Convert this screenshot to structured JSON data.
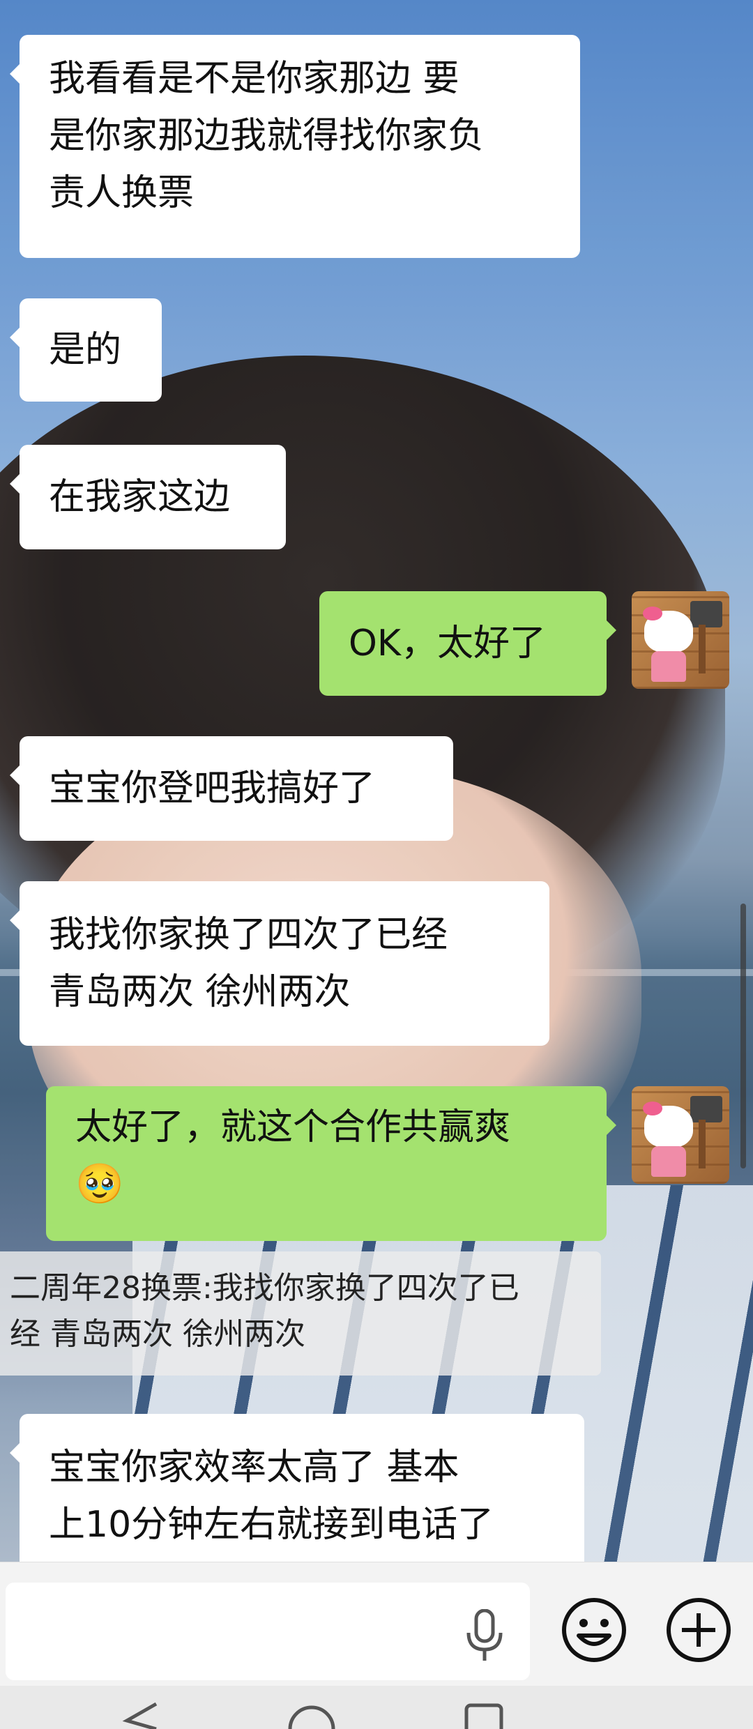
{
  "messages": [
    {
      "side": "in",
      "text_lines": [
        "我看看是不是你家那边 要",
        "是你家那边我就得找你家负",
        "责人换票"
      ]
    },
    {
      "side": "in",
      "text": "是的"
    },
    {
      "side": "in",
      "text": "在我家这边"
    },
    {
      "side": "out",
      "text": "OK，太好了"
    },
    {
      "side": "in",
      "text": "宝宝你登吧我搞好了"
    },
    {
      "side": "in",
      "text_lines": [
        "我找你家换了四次了已经",
        "青岛两次 徐州两次"
      ]
    },
    {
      "side": "out",
      "text_lines": [
        "太好了，就这个合作共赢爽",
        "🥹"
      ]
    },
    {
      "side": "in",
      "text_lines": [
        "宝宝你家效率太高了 基本",
        "上10分钟左右就接到电话了"
      ]
    }
  ],
  "quoted_reply": {
    "lines": [
      "二周年28换票:我找你家换了四次了已",
      "经 青岛两次 徐州两次"
    ]
  },
  "input_bar": {
    "icons": [
      "microphone-icon",
      "emoji-icon",
      "plus-icon"
    ]
  },
  "nav_bar": {
    "icons": [
      "back-icon",
      "home-icon",
      "recents-icon"
    ]
  },
  "colors": {
    "outgoing_bubble": "#a4e26f",
    "incoming_bubble": "#ffffff"
  }
}
